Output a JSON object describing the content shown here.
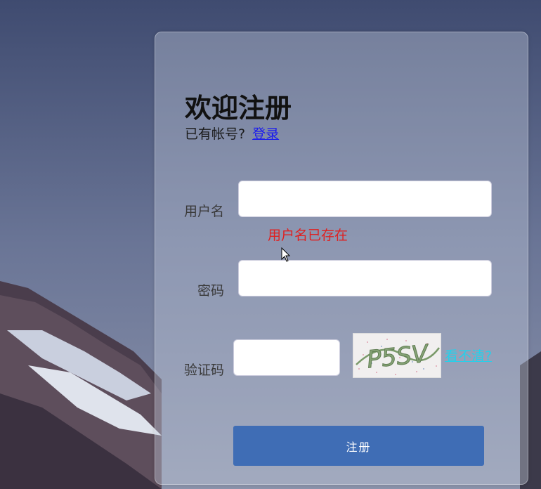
{
  "form": {
    "title": "欢迎注册",
    "has_account_text": "已有帐号?",
    "login_link": "登录",
    "username_label": "用户名",
    "username_value": "",
    "username_error": "用户名已存在",
    "password_label": "密码",
    "password_value": "",
    "captcha_label": "验证码",
    "captcha_value": "",
    "captcha_image_text": "P5SV",
    "refresh_captcha_link": "看不清?",
    "submit_label": "注册"
  },
  "colors": {
    "submit_button": "#3f6db5",
    "error_text": "#e02020",
    "login_link": "#1a1aee",
    "refresh_link": "#25d0ea"
  }
}
